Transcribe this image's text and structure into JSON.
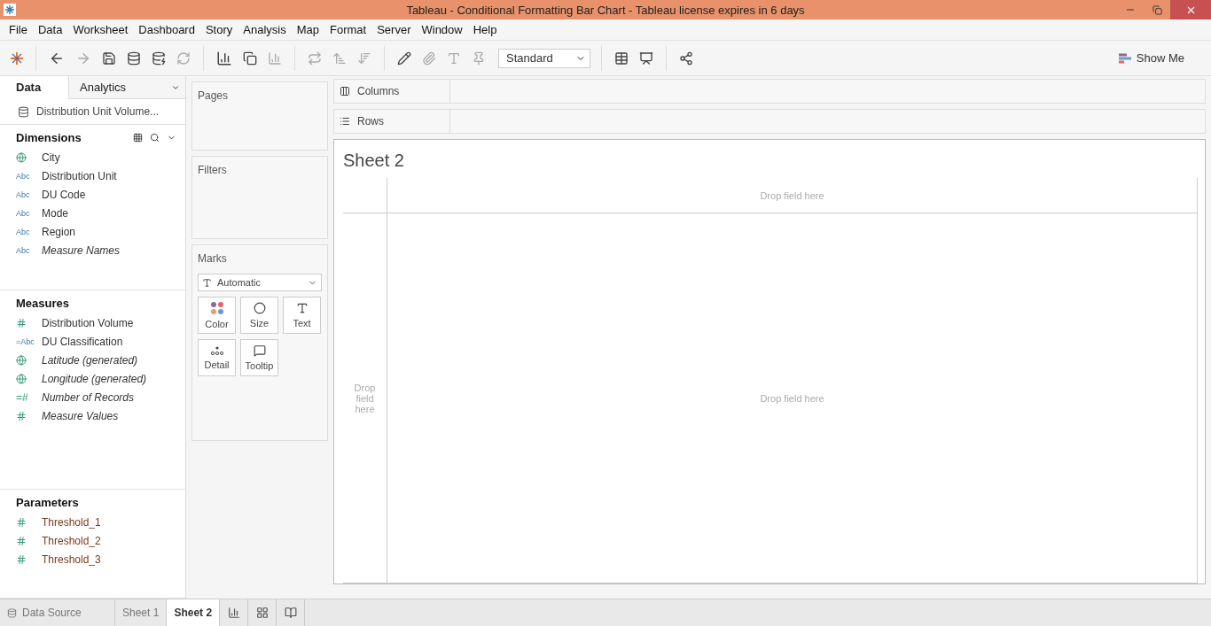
{
  "window": {
    "title": "Tableau - Conditional Formatting Bar Chart - Tableau license expires in 6 days"
  },
  "menu": [
    "File",
    "Data",
    "Worksheet",
    "Dashboard",
    "Story",
    "Analysis",
    "Map",
    "Format",
    "Server",
    "Window",
    "Help"
  ],
  "toolbar": {
    "fit": "Standard",
    "show_me": "Show Me"
  },
  "side_tabs": [
    {
      "label": "Data",
      "selected": true
    },
    {
      "label": "Analytics",
      "selected": false
    }
  ],
  "datasource": "Distribution Unit Volume...",
  "dimensions": {
    "title": "Dimensions",
    "fields": [
      {
        "name": "City",
        "kind": "globe",
        "italic": false
      },
      {
        "name": "Distribution Unit",
        "kind": "text",
        "symbol": "Abc",
        "italic": false
      },
      {
        "name": "DU Code",
        "kind": "text",
        "symbol": "Abc",
        "italic": false
      },
      {
        "name": "Mode",
        "kind": "text",
        "symbol": "Abc",
        "italic": false
      },
      {
        "name": "Region",
        "kind": "text",
        "symbol": "Abc",
        "italic": false
      },
      {
        "name": "Measure Names",
        "kind": "text",
        "symbol": "Abc",
        "italic": true
      }
    ]
  },
  "measures": {
    "title": "Measures",
    "fields": [
      {
        "name": "Distribution Volume",
        "kind": "hash",
        "italic": false
      },
      {
        "name": "DU Classification",
        "kind": "text",
        "symbol": "=Abc",
        "italic": false
      },
      {
        "name": "Latitude (generated)",
        "kind": "globe",
        "italic": true
      },
      {
        "name": "Longitude (generated)",
        "kind": "globe",
        "italic": true
      },
      {
        "name": "Number of Records",
        "kind": "text",
        "symbol": "=#",
        "italic": true
      },
      {
        "name": "Measure Values",
        "kind": "hash",
        "italic": true
      }
    ]
  },
  "parameters": {
    "title": "Parameters",
    "fields": [
      {
        "name": "Threshold_1",
        "kind": "hash",
        "italic": false
      },
      {
        "name": "Threshold_2",
        "kind": "hash",
        "italic": false
      },
      {
        "name": "Threshold_3",
        "kind": "hash",
        "italic": false
      }
    ]
  },
  "pages": {
    "title": "Pages"
  },
  "filters": {
    "title": "Filters"
  },
  "marks": {
    "title": "Marks",
    "type": "Automatic",
    "buttons": [
      {
        "label": "Color",
        "kind": "color"
      },
      {
        "label": "Size",
        "kind": "size"
      },
      {
        "label": "Text",
        "kind": "text"
      },
      {
        "label": "Detail",
        "kind": "detail"
      },
      {
        "label": "Tooltip",
        "kind": "tooltip"
      }
    ]
  },
  "shelves": [
    {
      "label": "Columns",
      "kind": "columns"
    },
    {
      "label": "Rows",
      "kind": "rows"
    }
  ],
  "sheet": {
    "title": "Sheet 2",
    "top_drop": "Drop field here",
    "left_drop": "Drop field here",
    "center_drop": "Drop field here"
  },
  "bottom_tabs": [
    {
      "label": "Data Source",
      "kind": "source",
      "selected": false
    },
    {
      "label": "Sheet 1",
      "kind": "sheet",
      "selected": false
    },
    {
      "label": "Sheet 2",
      "kind": "sheet",
      "selected": true
    }
  ]
}
